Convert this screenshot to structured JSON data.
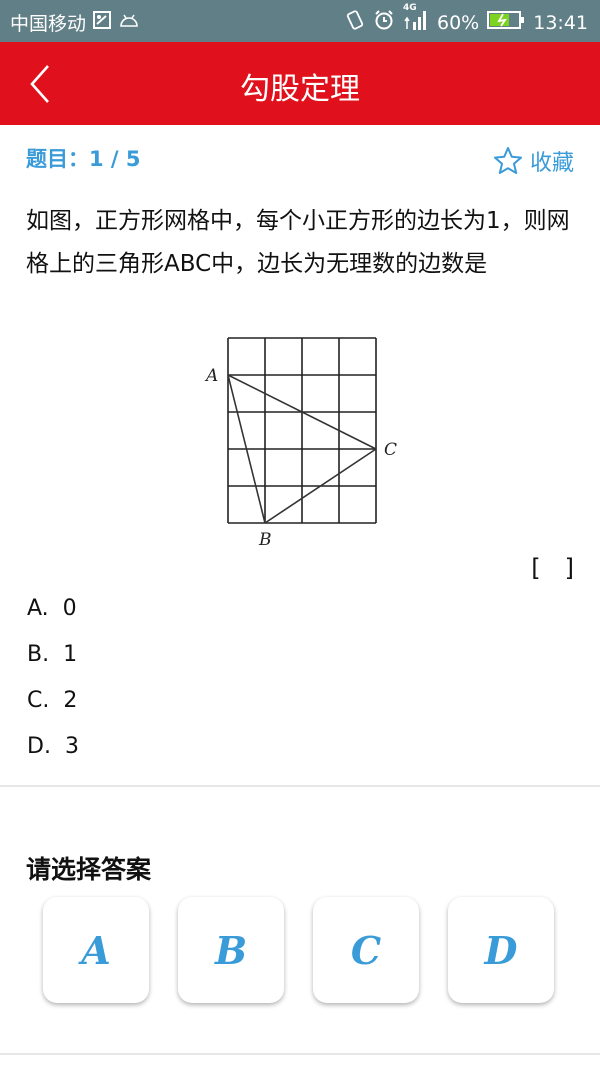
{
  "status_bar": {
    "carrier": "中国移动",
    "network": "4G",
    "battery": "60%",
    "time": "13:41"
  },
  "app_bar": {
    "title": "勾股定理",
    "back_icon": "chevron-left-icon"
  },
  "question": {
    "counter_label": "题目：",
    "counter_value": "1 / 5",
    "favorite_label": "收藏",
    "favorite_icon": "star-outline-icon",
    "text": "如图，正方形网格中，每个小正方形的边长为1，则网格上的三角形ABC中，边长为无理数的边数是",
    "answer_bracket": "[　]",
    "figure": {
      "grid_columns": 4,
      "grid_rows": 5,
      "points": {
        "A": {
          "label": "A",
          "col": 0,
          "row": 1
        },
        "B": {
          "label": "B",
          "col": 1,
          "row": 5
        },
        "C": {
          "label": "C",
          "col": 4,
          "row": 3
        }
      }
    },
    "options": [
      {
        "letter": "A.",
        "value": "0"
      },
      {
        "letter": "B.",
        "value": "1"
      },
      {
        "letter": "C.",
        "value": "2"
      },
      {
        "letter": "D.",
        "value": "3"
      }
    ]
  },
  "answer_section": {
    "title": "请选择答案",
    "choices": [
      "A",
      "B",
      "C",
      "D"
    ]
  },
  "colors": {
    "accent": "#3a9bd9",
    "app_bar": "#e0111c",
    "status_bar": "#617f87"
  }
}
